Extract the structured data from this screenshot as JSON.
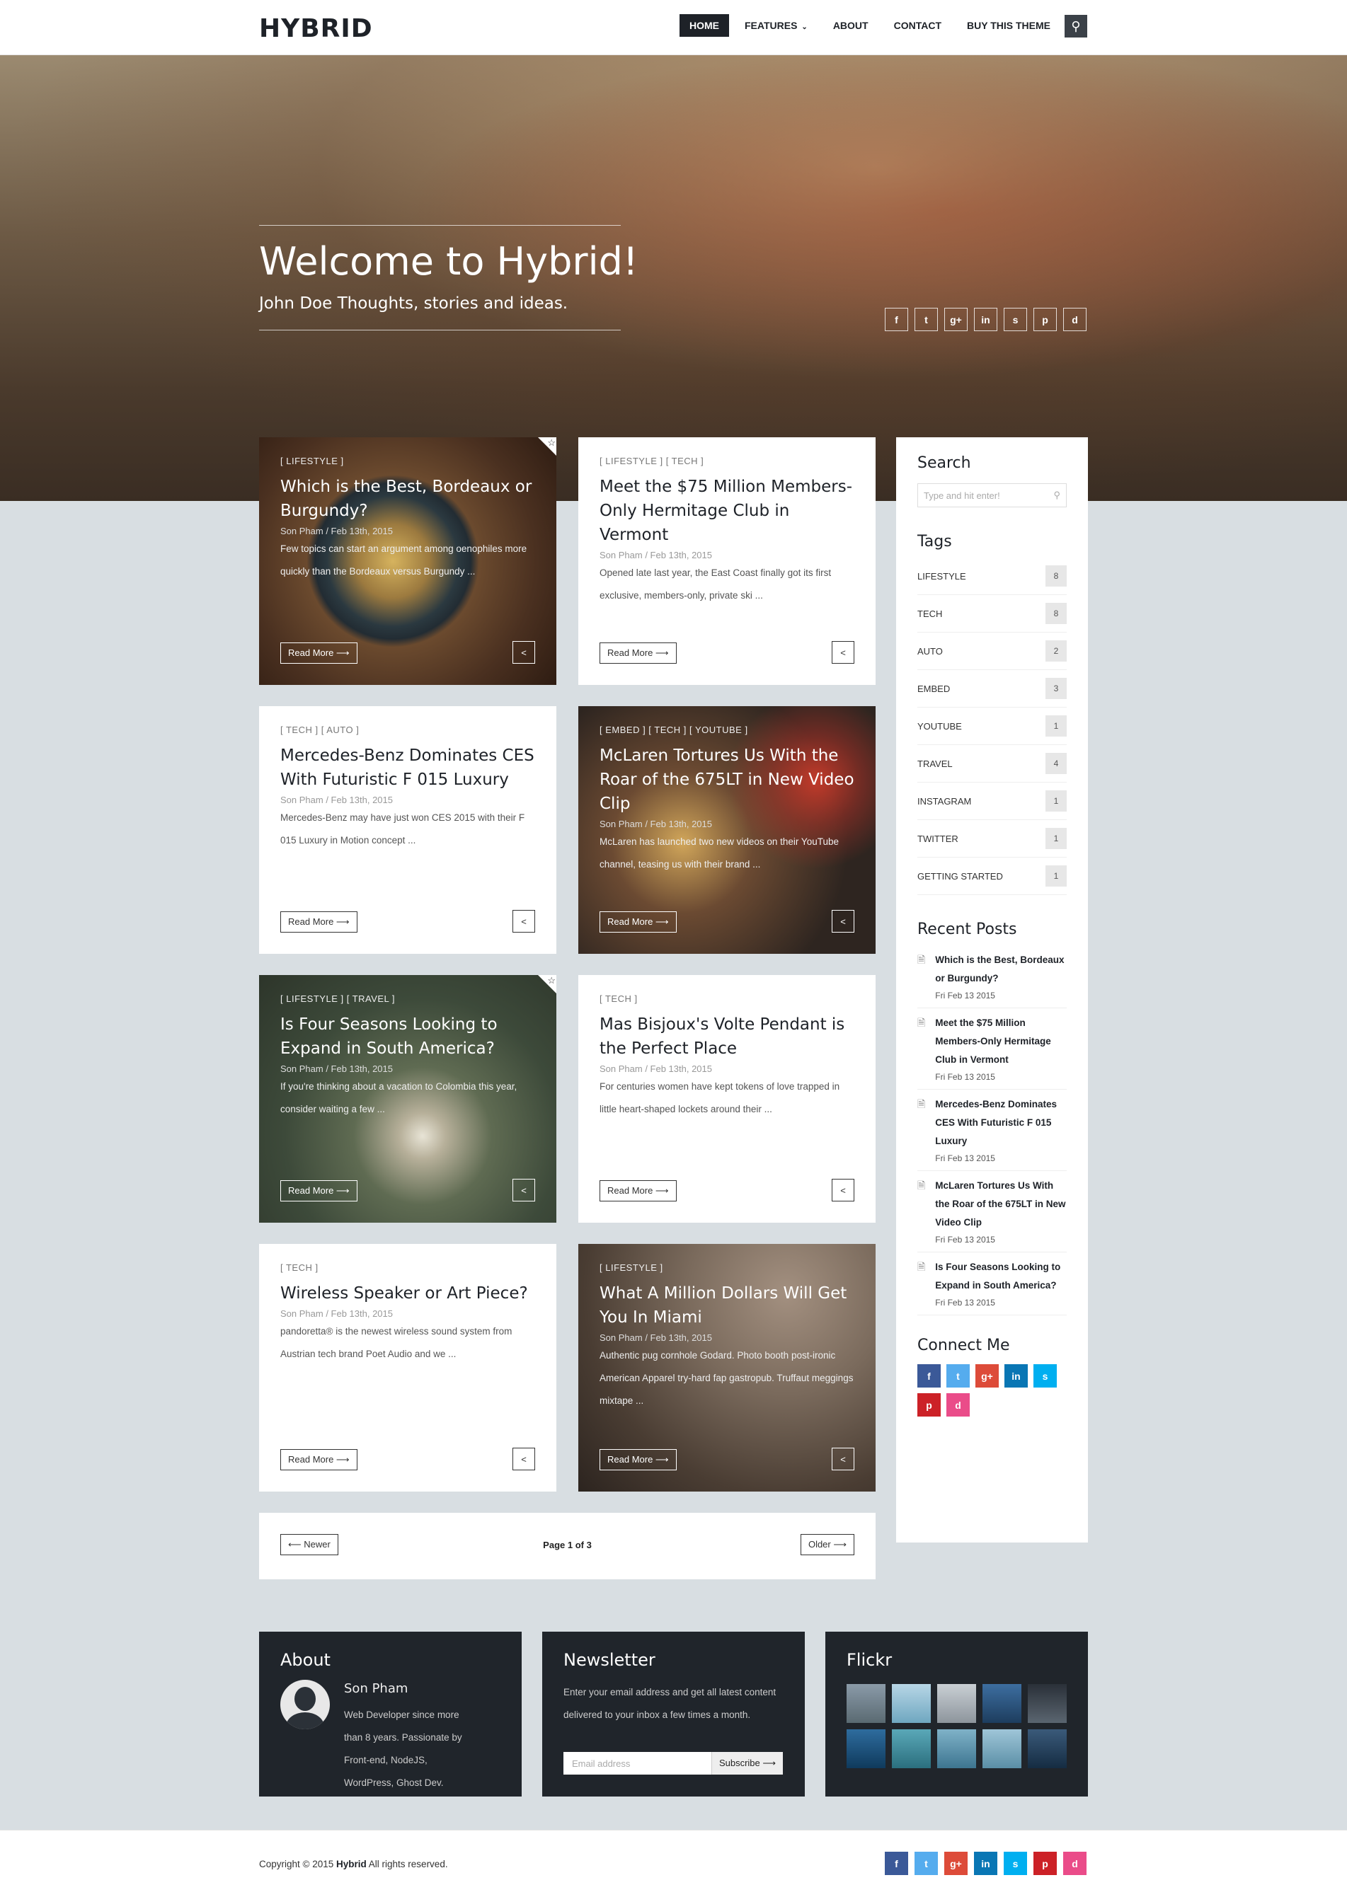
{
  "header": {
    "logo": "HYBRID",
    "nav": [
      "HOME",
      "FEATURES",
      "ABOUT",
      "CONTACT",
      "BUY THIS THEME"
    ],
    "features_chevron": "⌄",
    "search_icon": "⚲"
  },
  "hero": {
    "title": "Welcome to Hybrid!",
    "subtitle": "John Doe Thoughts, stories and ideas.",
    "social": [
      "f",
      "t",
      "g+",
      "in",
      "s",
      "p",
      "d"
    ]
  },
  "posts": [
    {
      "tags": "[ LIFESTYLE ]",
      "title": "Which is the Best, Bordeaux or Burgundy?",
      "meta": "Son Pham / Feb 13th, 2015",
      "excerpt": "Few topics can start an argument among oenophiles more quickly than the Bordeaux versus Burgundy ...",
      "read_more": "Read More ⟶",
      "share": "<"
    },
    {
      "tags": "[ LIFESTYLE ]   [ TECH ]",
      "title": "Meet the $75 Million Members-Only Hermitage Club in Vermont",
      "meta": "Son Pham / Feb 13th, 2015",
      "excerpt": "Opened late last year, the East Coast finally got its first exclusive, members-only, private ski ...",
      "read_more": "Read More ⟶",
      "share": "<"
    },
    {
      "tags": "[ TECH ]   [ AUTO ]",
      "title": "Mercedes-Benz Dominates CES With Futuristic F 015 Luxury",
      "meta": "Son Pham / Feb 13th, 2015",
      "excerpt": "Mercedes-Benz may have just won CES 2015 with their F 015 Luxury in Motion concept ...",
      "read_more": "Read More ⟶",
      "share": "<"
    },
    {
      "tags": "[ EMBED ]   [ TECH ]   [ YOUTUBE ]",
      "title": "McLaren Tortures Us With the Roar of the 675LT in New Video Clip",
      "meta": "Son Pham / Feb 13th, 2015",
      "excerpt": "McLaren has launched two new videos on their YouTube channel, teasing us with their brand ...",
      "read_more": "Read More ⟶",
      "share": "<"
    },
    {
      "tags": "[ LIFESTYLE ]   [ TRAVEL ]",
      "title": "Is Four Seasons Looking to Expand in South America?",
      "meta": "Son Pham / Feb 13th, 2015",
      "excerpt": "If you're thinking about a vacation to Colombia this year, consider waiting a few ...",
      "read_more": "Read More ⟶",
      "share": "<"
    },
    {
      "tags": "[ TECH ]",
      "title": "Mas Bisjoux's Volte Pendant is the Perfect Place",
      "meta": "Son Pham / Feb 13th, 2015",
      "excerpt": "For centuries women have kept tokens of love trapped in little heart-shaped lockets around their ...",
      "read_more": "Read More ⟶",
      "share": "<"
    },
    {
      "tags": "[ TECH ]",
      "title": "Wireless Speaker or Art Piece?",
      "meta": "Son Pham / Feb 13th, 2015",
      "excerpt": "pandoretta® is the newest wireless sound system from Austrian tech brand Poet Audio and we ...",
      "read_more": "Read More ⟶",
      "share": "<"
    },
    {
      "tags": "[ LIFESTYLE ]",
      "title": "What A Million Dollars Will Get You In Miami",
      "meta": "Son Pham / Feb 13th, 2015",
      "excerpt": "Authentic pug cornhole Godard. Photo booth post-ironic American Apparel try-hard fap gastropub. Truffaut meggings mixtape ...",
      "read_more": "Read More ⟶",
      "share": "<"
    }
  ],
  "pager": {
    "newer": "⟵ Newer",
    "label": "Page 1 of 3",
    "older": "Older ⟶"
  },
  "sidebar": {
    "search_title": "Search",
    "search_placeholder": "Type and hit enter!",
    "tags_title": "Tags",
    "tags": [
      {
        "name": "LIFESTYLE",
        "count": "8"
      },
      {
        "name": "TECH",
        "count": "8"
      },
      {
        "name": "AUTO",
        "count": "2"
      },
      {
        "name": "EMBED",
        "count": "3"
      },
      {
        "name": "YOUTUBE",
        "count": "1"
      },
      {
        "name": "TRAVEL",
        "count": "4"
      },
      {
        "name": "INSTAGRAM",
        "count": "1"
      },
      {
        "name": "TWITTER",
        "count": "1"
      },
      {
        "name": "GETTING STARTED",
        "count": "1"
      }
    ],
    "recent_title": "Recent Posts",
    "recent": [
      {
        "title": "Which is the Best, Bordeaux or Burgundy?",
        "date": "Fri Feb 13 2015"
      },
      {
        "title": "Meet the $75 Million Members-Only Hermitage Club in Vermont",
        "date": "Fri Feb 13 2015"
      },
      {
        "title": "Mercedes-Benz Dominates CES With Futuristic F 015 Luxury",
        "date": "Fri Feb 13 2015"
      },
      {
        "title": "McLaren Tortures Us With the Roar of the 675LT in New Video Clip",
        "date": "Fri Feb 13 2015"
      },
      {
        "title": "Is Four Seasons Looking to Expand in South America?",
        "date": "Fri Feb 13 2015"
      }
    ],
    "connect_title": "Connect Me"
  },
  "footer": {
    "about_title": "About",
    "about_name": "Son Pham",
    "about_text": "Web Developer since more than 8 years. Passionate by Front-end, NodeJS, WordPress, Ghost Dev.",
    "newsletter_title": "Newsletter",
    "newsletter_text": "Enter your email address and get all latest content delivered to your inbox a few times a month.",
    "email_placeholder": "Email address",
    "subscribe": "Subscribe ⟶",
    "flickr_title": "Flickr",
    "copyright_prefix": "Copyright © 2015 ",
    "copyright_brand": "Hybrid",
    "copyright_suffix": " All rights reserved."
  },
  "colors": {
    "facebook": "#3b5998",
    "twitter": "#55acee",
    "google": "#dd4b39",
    "linkedin": "#0976b4",
    "skype": "#00aff0",
    "pinterest": "#cc2127",
    "dribbble": "#ea4c89"
  }
}
